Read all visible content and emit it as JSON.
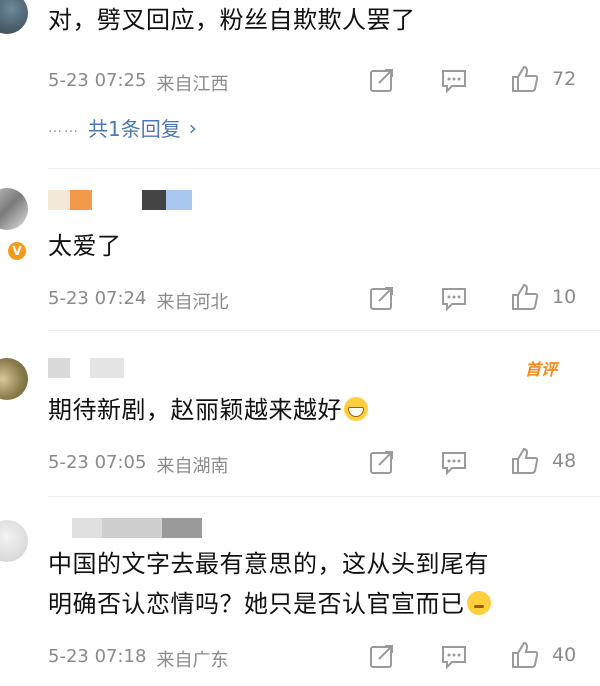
{
  "comments": [
    {
      "text": "对，劈叉回应，粉丝自欺欺人罢了",
      "date": "5-23 07:25",
      "location": "来自江西",
      "likes": "72",
      "reply_link": "共1条回复",
      "avatar_icon": "avatar-dark"
    },
    {
      "text": "太爱了",
      "date": "5-23 07:24",
      "location": "来自河北",
      "likes": "10",
      "verified_badge": "V",
      "avatar_icon": "avatar-gray"
    },
    {
      "text": "期待新剧，赵丽颖越来越好",
      "date": "5-23 07:05",
      "location": "来自湖南",
      "likes": "48",
      "badge": "首评",
      "emoji_icon": "grinning-face-icon",
      "avatar_icon": "avatar-landscape"
    },
    {
      "text_line1": "中国的文字去最有意思的，这从头到尾有",
      "text_line2": "明确否认恋情吗？她只是否认官宣而已",
      "date": "5-23 07:18",
      "location": "来自广东",
      "likes": "40",
      "emoji_icon": "thinking-face-icon",
      "avatar_icon": "avatar-light"
    }
  ],
  "colors": {
    "meta": "#8a8a8a",
    "link": "#4a78b5",
    "first_badge": "#f08a1c",
    "verified": "#f39b1c"
  }
}
